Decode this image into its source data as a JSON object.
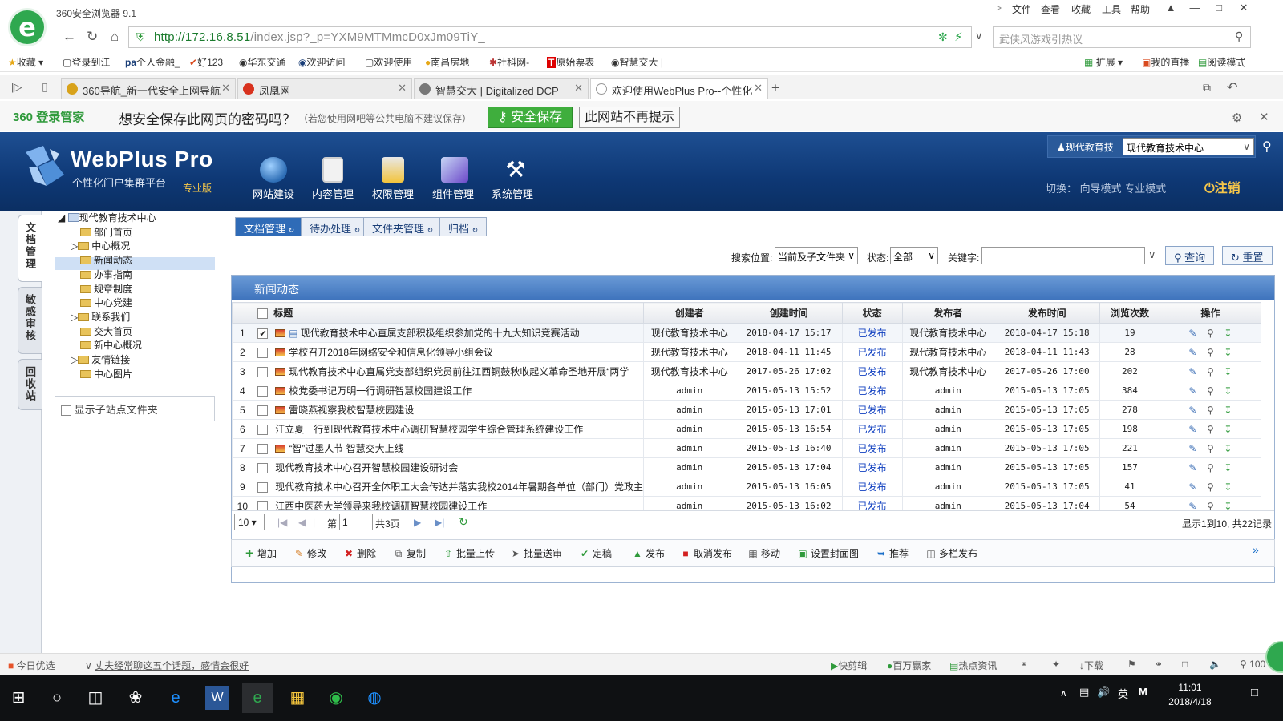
{
  "browser": {
    "app_title": "360安全浏览器 9.1",
    "menu": [
      "文件",
      "查看",
      "收藏",
      "工具",
      "帮助"
    ],
    "url_main": "http://172.16.8.51",
    "url_rest": "/index.jsp?_p=YXM9MTMmcD0xJm09TiY_",
    "search_placeholder": "武侠风游戏引热议",
    "bookmarks": [
      "收藏",
      "登录到江",
      "个人金融_",
      "好123",
      "华东交通",
      "欢迎访问",
      "欢迎使用",
      "南昌房地",
      "社科网-",
      "原始票表",
      "智慧交大"
    ],
    "right_tools": [
      "扩展",
      "我的直播",
      "阅读模式"
    ],
    "tabs": [
      {
        "label": "360导航_新一代安全上网导航",
        "color": "#d8a21a"
      },
      {
        "label": "凤凰网",
        "color": "#d8321e"
      },
      {
        "label": "智慧交大 | Digitalized DCP",
        "color": "#777777"
      },
      {
        "label": "欢迎使用WebPlus Pro--个性化",
        "color": "#2d4f8a"
      }
    ]
  },
  "password_bar": {
    "brand": "360 登录管家",
    "question": "想安全保存此网页的密码吗？",
    "note": "（若您使用网吧等公共电脑不建议保存）",
    "save_label": "安全保存",
    "never_label": "此网站不再提示"
  },
  "app": {
    "title": "WebPlus Pro",
    "subtitle": "个性化门户集群平台",
    "edition": "专业版",
    "modules": [
      "网站建设",
      "内容管理",
      "权限管理",
      "组件管理",
      "系统管理"
    ],
    "user_label": "现代教育技",
    "site_select": "现代教育技术中心",
    "switch_text": "切换：  向导模式  专业模式",
    "logout_label": "注销"
  },
  "side_tabs": [
    "文档管理",
    "敏感审核",
    "回收站"
  ],
  "tree": {
    "root": "现代教育技术中心",
    "children": [
      "部门首页",
      "中心概况",
      "新闻动态",
      "办事指南",
      "规章制度",
      "中心党建",
      "联系我们",
      "交大首页",
      "新中心概况",
      "友情链接",
      "中心图片"
    ],
    "selected": "新闻动态",
    "show_subsite": "显示子站点文件夹"
  },
  "main_tabs": [
    "文档管理",
    "待办处理",
    "文件夹管理",
    "归档"
  ],
  "filter": {
    "location_label": "搜索位置:",
    "location_value": "当前及子文件夹",
    "status_label": "状态:",
    "status_value": "全部",
    "keyword_label": "关键字:",
    "query_label": "查询",
    "reset_label": "重置"
  },
  "grid": {
    "title": "新闻动态",
    "columns": [
      "标题",
      "创建者",
      "创建时间",
      "状态",
      "发布者",
      "发布时间",
      "浏览次数",
      "操作"
    ],
    "rows": [
      {
        "n": "1",
        "title": "现代教育技术中心直属支部积极组织参加党的十九大知识竞赛活动",
        "creator": "现代教育技术中心",
        "created": "2018-04-17 15:17",
        "status": "已发布",
        "publisher": "现代教育技术中心",
        "published": "2018-04-17 15:18",
        "views": "19",
        "checked": true,
        "flag": true
      },
      {
        "n": "2",
        "title": "学校召开2018年网络安全和信息化领导小组会议",
        "creator": "现代教育技术中心",
        "created": "2018-04-11 11:45",
        "status": "已发布",
        "publisher": "现代教育技术中心",
        "published": "2018-04-11 11:43",
        "views": "28",
        "checked": false,
        "flag": true
      },
      {
        "n": "3",
        "title": "现代教育技术中心直属党支部组织党员前往江西铜鼓秋收起义革命圣地开展“两学",
        "creator": "现代教育技术中心",
        "created": "2017-05-26 17:02",
        "status": "已发布",
        "publisher": "现代教育技术中心",
        "published": "2017-05-26 17:00",
        "views": "202",
        "checked": false,
        "flag": true
      },
      {
        "n": "4",
        "title": "校党委书记万明一行调研智慧校园建设工作",
        "creator": "admin",
        "created": "2015-05-13 15:52",
        "status": "已发布",
        "publisher": "admin",
        "published": "2015-05-13 17:05",
        "views": "384",
        "checked": false,
        "flag": true
      },
      {
        "n": "5",
        "title": "雷晓燕视察我校智慧校园建设",
        "creator": "admin",
        "created": "2015-05-13 17:01",
        "status": "已发布",
        "publisher": "admin",
        "published": "2015-05-13 17:05",
        "views": "278",
        "checked": false,
        "flag": true
      },
      {
        "n": "6",
        "title": "汪立夏一行到现代教育技术中心调研智慧校园学生综合管理系统建设工作",
        "creator": "admin",
        "created": "2015-05-13 16:54",
        "status": "已发布",
        "publisher": "admin",
        "published": "2015-05-13 17:05",
        "views": "198",
        "checked": false,
        "flag": false
      },
      {
        "n": "7",
        "title": "“智”过墨人节  智慧交大上线",
        "creator": "admin",
        "created": "2015-05-13 16:40",
        "status": "已发布",
        "publisher": "admin",
        "published": "2015-05-13 17:05",
        "views": "221",
        "checked": false,
        "flag": true
      },
      {
        "n": "8",
        "title": "现代教育技术中心召开智慧校园建设研讨会",
        "creator": "admin",
        "created": "2015-05-13 17:04",
        "status": "已发布",
        "publisher": "admin",
        "published": "2015-05-13 17:05",
        "views": "157",
        "checked": false,
        "flag": false
      },
      {
        "n": "9",
        "title": "现代教育技术中心召开全体职工大会传达并落实我校2014年暑期各单位（部门）党政主",
        "creator": "admin",
        "created": "2015-05-13 16:05",
        "status": "已发布",
        "publisher": "admin",
        "published": "2015-05-13 17:05",
        "views": "41",
        "checked": false,
        "flag": false
      },
      {
        "n": "10",
        "title": "江西中医药大学领导来我校调研智慧校园建设工作",
        "creator": "admin",
        "created": "2015-05-13 16:02",
        "status": "已发布",
        "publisher": "admin",
        "published": "2015-05-13 17:04",
        "views": "54",
        "checked": false,
        "flag": false
      }
    ]
  },
  "pager": {
    "page_size": "10 ▾",
    "page_prefix": "第",
    "page_value": "1",
    "page_total": "共3页",
    "summary": "显示1到10, 共22记录"
  },
  "toolbar": [
    "增加",
    "修改",
    "删除",
    "复制",
    "批量上传",
    "批量送审",
    "定稿",
    "发布",
    "取消发布",
    "移动",
    "设置封面图",
    "推荐",
    "多栏发布"
  ],
  "statusbar": {
    "left1": "今日优选",
    "left2": "丈夫经常聊这五个话题，感情会很好",
    "right": [
      "快剪辑",
      "百万赢家",
      "热点资讯",
      "下载",
      "100"
    ]
  },
  "taskbar": {
    "time": "11:01",
    "date": "2018/4/18",
    "ime": "英"
  }
}
